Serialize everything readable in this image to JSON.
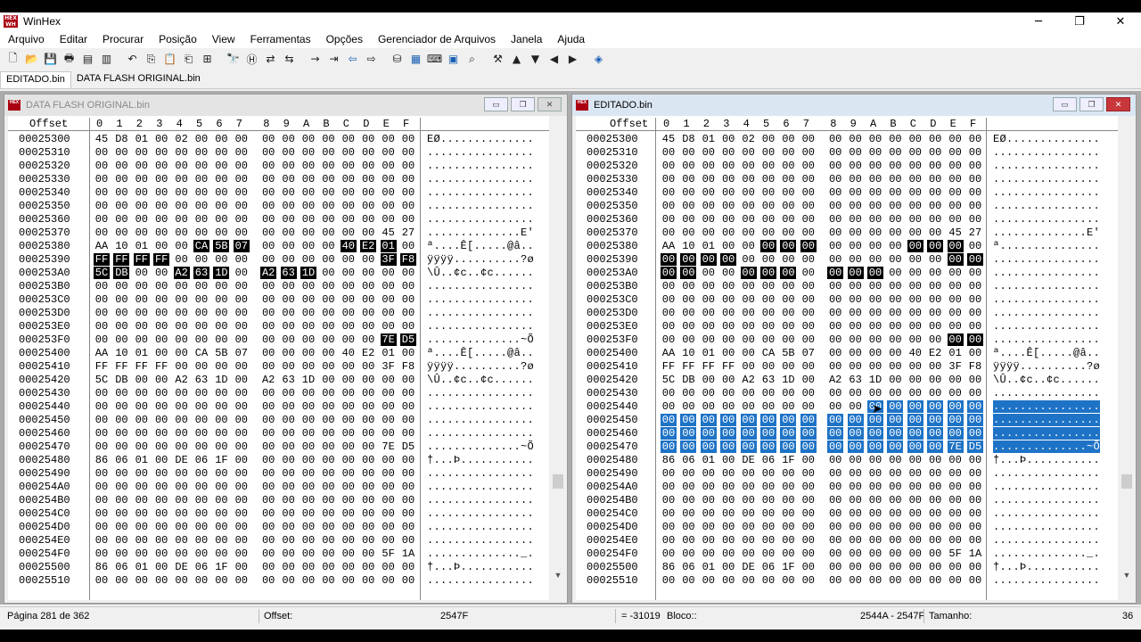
{
  "app": {
    "title": "WinHex",
    "logo_text": "HEX WH"
  },
  "window_controls": {
    "minimize": "─",
    "restore": "❐",
    "close": "✕"
  },
  "menu": [
    "Arquivo",
    "Editar",
    "Procurar",
    "Posição",
    "View",
    "Ferramentas",
    "Opções",
    "Gerenciador de Arquivos",
    "Janela",
    "Ajuda"
  ],
  "toolbar": [
    {
      "icon": "new-file-icon",
      "glyph": "🗋"
    },
    {
      "icon": "open-folder-icon",
      "glyph": "📂"
    },
    {
      "icon": "save-icon",
      "glyph": "💾"
    },
    {
      "icon": "print-icon",
      "glyph": "🖶"
    },
    {
      "icon": "properties-icon",
      "glyph": "▤"
    },
    {
      "icon": "open-drive-icon",
      "glyph": "▥"
    },
    {
      "sep": true
    },
    {
      "icon": "undo-icon",
      "glyph": "↶"
    },
    {
      "icon": "copy-icon",
      "glyph": "⎘"
    },
    {
      "icon": "paste-icon",
      "glyph": "📋"
    },
    {
      "icon": "paste-write-icon",
      "glyph": "⎗"
    },
    {
      "icon": "binary-icon",
      "glyph": "⊞"
    },
    {
      "sep": true
    },
    {
      "icon": "find-text-icon",
      "glyph": "🔭"
    },
    {
      "icon": "find-hex-icon",
      "glyph": "Ⓗ"
    },
    {
      "icon": "replace-text-icon",
      "glyph": "⇄"
    },
    {
      "icon": "replace-hex-icon",
      "glyph": "⇆"
    },
    {
      "sep": true
    },
    {
      "icon": "goto-offset-icon",
      "glyph": "→"
    },
    {
      "icon": "goto-icon",
      "glyph": "⇥"
    },
    {
      "icon": "back-icon",
      "glyph": "⇦",
      "blue": true
    },
    {
      "icon": "forward-icon",
      "glyph": "⇨"
    },
    {
      "sep": true
    },
    {
      "icon": "disk-tools-icon",
      "glyph": "⛁"
    },
    {
      "icon": "ram-icon",
      "glyph": "▦",
      "blue": true
    },
    {
      "icon": "calculator-icon",
      "glyph": "⌨"
    },
    {
      "icon": "analyze-icon",
      "glyph": "▣",
      "blue": true
    },
    {
      "icon": "search-icon",
      "glyph": "⌕"
    },
    {
      "sep": true
    },
    {
      "icon": "checksum-icon",
      "glyph": "⚒"
    },
    {
      "icon": "up-icon",
      "glyph": "▲"
    },
    {
      "icon": "down-icon",
      "glyph": "▼"
    },
    {
      "icon": "left-icon",
      "glyph": "◀"
    },
    {
      "icon": "right-icon",
      "glyph": "▶"
    },
    {
      "sep": true
    },
    {
      "icon": "help-book-icon",
      "glyph": "◈",
      "blue": true
    }
  ],
  "tabs": [
    "EDITADO.bin",
    "DATA FLASH ORIGINAL.bin"
  ],
  "columns_label": "Offset",
  "hex_columns": [
    "0",
    "1",
    "2",
    "3",
    "4",
    "5",
    "6",
    "7",
    "8",
    "9",
    "A",
    "B",
    "C",
    "D",
    "E",
    "F"
  ],
  "left_window": {
    "title": "DATA FLASH ORIGINAL.bin",
    "rows": [
      {
        "o": "00025300",
        "h": "45 D8 01 00 02 00 00 00 00 00 00 00 00 00 00 00",
        "a": "EØ..............",
        "s": ""
      },
      {
        "o": "00025310",
        "h": "00 00 00 00 00 00 00 00 00 00 00 00 00 00 00 00",
        "a": "................",
        "s": ""
      },
      {
        "o": "00025320",
        "h": "00 00 00 00 00 00 00 00 00 00 00 00 00 00 00 00",
        "a": "................",
        "s": ""
      },
      {
        "o": "00025330",
        "h": "00 00 00 00 00 00 00 00 00 00 00 00 00 00 00 00",
        "a": "................",
        "s": ""
      },
      {
        "o": "00025340",
        "h": "00 00 00 00 00 00 00 00 00 00 00 00 00 00 00 00",
        "a": "................",
        "s": ""
      },
      {
        "o": "00025350",
        "h": "00 00 00 00 00 00 00 00 00 00 00 00 00 00 00 00",
        "a": "................",
        "s": ""
      },
      {
        "o": "00025360",
        "h": "00 00 00 00 00 00 00 00 00 00 00 00 00 00 00 00",
        "a": "................",
        "s": ""
      },
      {
        "o": "00025370",
        "h": "00 00 00 00 00 00 00 00 00 00 00 00 00 00 45 27",
        "a": "..............E'",
        "s": ""
      },
      {
        "o": "00025380",
        "h": "AA 10 01 00 00 CA 5B 07 00 00 00 00 40 E2 01 00",
        "a": "ª....Ê[.....@â..",
        "s": "0000011100001110"
      },
      {
        "o": "00025390",
        "h": "FF FF FF FF 00 00 00 00 00 00 00 00 00 00 3F F8",
        "a": "ÿÿÿÿ..........?ø",
        "s": "1111000000000011"
      },
      {
        "o": "000253A0",
        "h": "5C DB 00 00 A2 63 1D 00 A2 63 1D 00 00 00 00 00",
        "a": "\\Û..¢c..¢c......",
        "s": "1100111011100000"
      },
      {
        "o": "000253B0",
        "h": "00 00 00 00 00 00 00 00 00 00 00 00 00 00 00 00",
        "a": "................",
        "s": ""
      },
      {
        "o": "000253C0",
        "h": "00 00 00 00 00 00 00 00 00 00 00 00 00 00 00 00",
        "a": "................",
        "s": ""
      },
      {
        "o": "000253D0",
        "h": "00 00 00 00 00 00 00 00 00 00 00 00 00 00 00 00",
        "a": "................",
        "s": ""
      },
      {
        "o": "000253E0",
        "h": "00 00 00 00 00 00 00 00 00 00 00 00 00 00 00 00",
        "a": "................",
        "s": ""
      },
      {
        "o": "000253F0",
        "h": "00 00 00 00 00 00 00 00 00 00 00 00 00 00 7E D5",
        "a": "..............~Õ",
        "s": "0000000000000011"
      },
      {
        "o": "00025400",
        "h": "AA 10 01 00 00 CA 5B 07 00 00 00 00 40 E2 01 00",
        "a": "ª....Ê[.....@â..",
        "s": ""
      },
      {
        "o": "00025410",
        "h": "FF FF FF FF 00 00 00 00 00 00 00 00 00 00 3F F8",
        "a": "ÿÿÿÿ..........?ø",
        "s": ""
      },
      {
        "o": "00025420",
        "h": "5C DB 00 00 A2 63 1D 00 A2 63 1D 00 00 00 00 00",
        "a": "\\Û..¢c..¢c......",
        "s": ""
      },
      {
        "o": "00025430",
        "h": "00 00 00 00 00 00 00 00 00 00 00 00 00 00 00 00",
        "a": "................",
        "s": ""
      },
      {
        "o": "00025440",
        "h": "00 00 00 00 00 00 00 00 00 00 00 00 00 00 00 00",
        "a": "................",
        "s": ""
      },
      {
        "o": "00025450",
        "h": "00 00 00 00 00 00 00 00 00 00 00 00 00 00 00 00",
        "a": "................",
        "s": ""
      },
      {
        "o": "00025460",
        "h": "00 00 00 00 00 00 00 00 00 00 00 00 00 00 00 00",
        "a": "................",
        "s": ""
      },
      {
        "o": "00025470",
        "h": "00 00 00 00 00 00 00 00 00 00 00 00 00 00 7E D5",
        "a": "..............~Õ",
        "s": ""
      },
      {
        "o": "00025480",
        "h": "86 06 01 00 DE 06 1F 00 00 00 00 00 00 00 00 00",
        "a": "†...Þ...........",
        "s": ""
      },
      {
        "o": "00025490",
        "h": "00 00 00 00 00 00 00 00 00 00 00 00 00 00 00 00",
        "a": "................",
        "s": ""
      },
      {
        "o": "000254A0",
        "h": "00 00 00 00 00 00 00 00 00 00 00 00 00 00 00 00",
        "a": "................",
        "s": ""
      },
      {
        "o": "000254B0",
        "h": "00 00 00 00 00 00 00 00 00 00 00 00 00 00 00 00",
        "a": "................",
        "s": ""
      },
      {
        "o": "000254C0",
        "h": "00 00 00 00 00 00 00 00 00 00 00 00 00 00 00 00",
        "a": "................",
        "s": ""
      },
      {
        "o": "000254D0",
        "h": "00 00 00 00 00 00 00 00 00 00 00 00 00 00 00 00",
        "a": "................",
        "s": ""
      },
      {
        "o": "000254E0",
        "h": "00 00 00 00 00 00 00 00 00 00 00 00 00 00 00 00",
        "a": "................",
        "s": ""
      },
      {
        "o": "000254F0",
        "h": "00 00 00 00 00 00 00 00 00 00 00 00 00 00 5F 1A",
        "a": ".............._.",
        "s": ""
      },
      {
        "o": "00025500",
        "h": "86 06 01 00 DE 06 1F 00 00 00 00 00 00 00 00 00",
        "a": "†...Þ...........",
        "s": ""
      },
      {
        "o": "00025510",
        "h": "00 00 00 00 00 00 00 00 00 00 00 00 00 00 00 00",
        "a": "................",
        "s": ""
      }
    ]
  },
  "right_window": {
    "title": "EDITADO.bin",
    "rows": [
      {
        "o": "00025300",
        "h": "45 D8 01 00 02 00 00 00 00 00 00 00 00 00 00 00",
        "a": "EØ..............",
        "s": "",
        "b": ""
      },
      {
        "o": "00025310",
        "h": "00 00 00 00 00 00 00 00 00 00 00 00 00 00 00 00",
        "a": "................",
        "s": "",
        "b": ""
      },
      {
        "o": "00025320",
        "h": "00 00 00 00 00 00 00 00 00 00 00 00 00 00 00 00",
        "a": "................",
        "s": "",
        "b": ""
      },
      {
        "o": "00025330",
        "h": "00 00 00 00 00 00 00 00 00 00 00 00 00 00 00 00",
        "a": "................",
        "s": "",
        "b": ""
      },
      {
        "o": "00025340",
        "h": "00 00 00 00 00 00 00 00 00 00 00 00 00 00 00 00",
        "a": "................",
        "s": "",
        "b": ""
      },
      {
        "o": "00025350",
        "h": "00 00 00 00 00 00 00 00 00 00 00 00 00 00 00 00",
        "a": "................",
        "s": "",
        "b": ""
      },
      {
        "o": "00025360",
        "h": "00 00 00 00 00 00 00 00 00 00 00 00 00 00 00 00",
        "a": "................",
        "s": "",
        "b": ""
      },
      {
        "o": "00025370",
        "h": "00 00 00 00 00 00 00 00 00 00 00 00 00 00 45 27",
        "a": "..............E'",
        "s": "",
        "b": ""
      },
      {
        "o": "00025380",
        "h": "AA 10 01 00 00 00 00 00 00 00 00 00 00 00 00 00",
        "a": "ª...............",
        "s": "0000011100001110",
        "b": ""
      },
      {
        "o": "00025390",
        "h": "00 00 00 00 00 00 00 00 00 00 00 00 00 00 00 00",
        "a": "................",
        "s": "1111000000000011",
        "b": ""
      },
      {
        "o": "000253A0",
        "h": "00 00 00 00 00 00 00 00 00 00 00 00 00 00 00 00",
        "a": "................",
        "s": "1100111011100000",
        "b": ""
      },
      {
        "o": "000253B0",
        "h": "00 00 00 00 00 00 00 00 00 00 00 00 00 00 00 00",
        "a": "................",
        "s": "",
        "b": ""
      },
      {
        "o": "000253C0",
        "h": "00 00 00 00 00 00 00 00 00 00 00 00 00 00 00 00",
        "a": "................",
        "s": "",
        "b": ""
      },
      {
        "o": "000253D0",
        "h": "00 00 00 00 00 00 00 00 00 00 00 00 00 00 00 00",
        "a": "................",
        "s": "",
        "b": ""
      },
      {
        "o": "000253E0",
        "h": "00 00 00 00 00 00 00 00 00 00 00 00 00 00 00 00",
        "a": "................",
        "s": "",
        "b": ""
      },
      {
        "o": "000253F0",
        "h": "00 00 00 00 00 00 00 00 00 00 00 00 00 00 00 00",
        "a": "................",
        "s": "0000000000000011",
        "b": ""
      },
      {
        "o": "00025400",
        "h": "AA 10 01 00 00 CA 5B 07 00 00 00 00 40 E2 01 00",
        "a": "ª....Ê[.....@â..",
        "s": "",
        "b": ""
      },
      {
        "o": "00025410",
        "h": "FF FF FF FF 00 00 00 00 00 00 00 00 00 00 3F F8",
        "a": "ÿÿÿÿ..........?ø",
        "s": "",
        "b": ""
      },
      {
        "o": "00025420",
        "h": "5C DB 00 00 A2 63 1D 00 A2 63 1D 00 00 00 00 00",
        "a": "\\Û..¢c..¢c......",
        "s": "",
        "b": ""
      },
      {
        "o": "00025430",
        "h": "00 00 00 00 00 00 00 00 00 00 00 00 00 00 00 00",
        "a": "................",
        "s": "",
        "b": ""
      },
      {
        "o": "00025440",
        "h": "00 00 00 00 00 00 00 00 00 00 00 00 00 00 00 00",
        "a": "................",
        "s": "",
        "b": "0000000000111111"
      },
      {
        "o": "00025450",
        "h": "00 00 00 00 00 00 00 00 00 00 00 00 00 00 00 00",
        "a": "................",
        "s": "",
        "b": "1111111111111111"
      },
      {
        "o": "00025460",
        "h": "00 00 00 00 00 00 00 00 00 00 00 00 00 00 00 00",
        "a": "................",
        "s": "",
        "b": "1111111111111111"
      },
      {
        "o": "00025470",
        "h": "00 00 00 00 00 00 00 00 00 00 00 00 00 00 7E D5",
        "a": "..............~Õ",
        "s": "",
        "b": "1111111111111111"
      },
      {
        "o": "00025480",
        "h": "86 06 01 00 DE 06 1F 00 00 00 00 00 00 00 00 00",
        "a": "†...Þ...........",
        "s": "",
        "b": ""
      },
      {
        "o": "00025490",
        "h": "00 00 00 00 00 00 00 00 00 00 00 00 00 00 00 00",
        "a": "................",
        "s": "",
        "b": ""
      },
      {
        "o": "000254A0",
        "h": "00 00 00 00 00 00 00 00 00 00 00 00 00 00 00 00",
        "a": "................",
        "s": "",
        "b": ""
      },
      {
        "o": "000254B0",
        "h": "00 00 00 00 00 00 00 00 00 00 00 00 00 00 00 00",
        "a": "................",
        "s": "",
        "b": ""
      },
      {
        "o": "000254C0",
        "h": "00 00 00 00 00 00 00 00 00 00 00 00 00 00 00 00",
        "a": "................",
        "s": "",
        "b": ""
      },
      {
        "o": "000254D0",
        "h": "00 00 00 00 00 00 00 00 00 00 00 00 00 00 00 00",
        "a": "................",
        "s": "",
        "b": ""
      },
      {
        "o": "000254E0",
        "h": "00 00 00 00 00 00 00 00 00 00 00 00 00 00 00 00",
        "a": "................",
        "s": "",
        "b": ""
      },
      {
        "o": "000254F0",
        "h": "00 00 00 00 00 00 00 00 00 00 00 00 00 00 5F 1A",
        "a": ".............._.",
        "s": "",
        "b": ""
      },
      {
        "o": "00025500",
        "h": "86 06 01 00 DE 06 1F 00 00 00 00 00 00 00 00 00",
        "a": "†...Þ...........",
        "s": "",
        "b": ""
      },
      {
        "o": "00025510",
        "h": "00 00 00 00 00 00 00 00 00 00 00 00 00 00 00 00",
        "a": "................",
        "s": "",
        "b": ""
      }
    ]
  },
  "status": {
    "page": "Página 281 de 362",
    "offset_label": "Offset:",
    "offset_value": "2547F",
    "decimal_value": "= -31019",
    "block_label": "Bloco::",
    "block_value": "2544A - 2547F",
    "size_label": "Tamanho:",
    "size_value": "36"
  },
  "colors": {
    "selection_dark": "#000000",
    "selection_blue": "#1e73c6",
    "logo": "#aa1111"
  }
}
